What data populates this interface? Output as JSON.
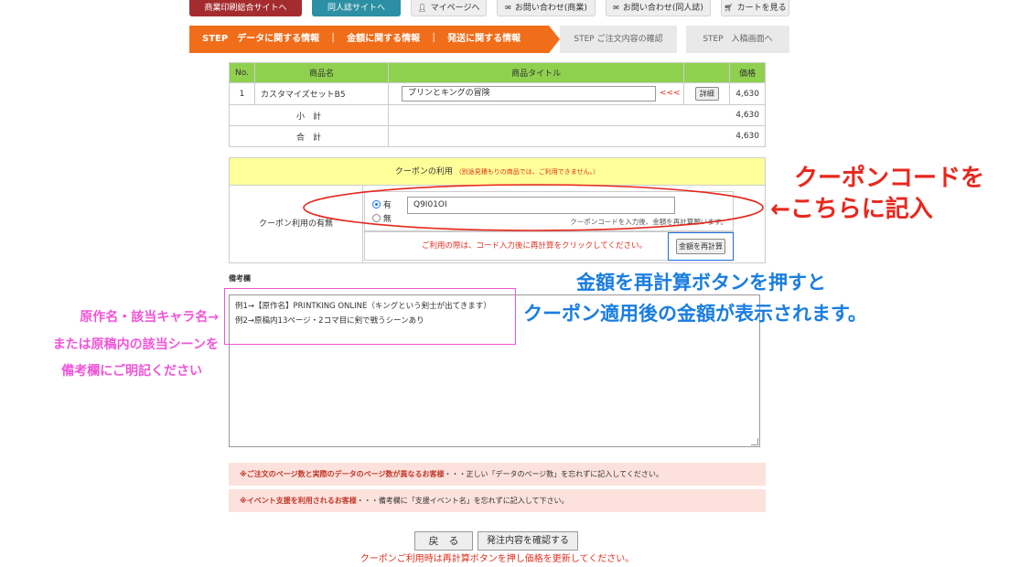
{
  "topnav": {
    "commercial_label": "商業印刷総合サイトへ",
    "doujin_label": "同人誌サイトへ",
    "mypage_label": "マイページへ",
    "contact_commercial_label": "お問い合わせ(商業)",
    "contact_doujin_label": "お問い合わせ(同人誌)",
    "cart_label": "カートを見る"
  },
  "steps": {
    "active_label": "STEP　データに関する情報　｜　金額に関する情報　｜　発送に関する情報",
    "step2_label": "STEP ご注文内容の確認",
    "step3_label": "STEP　入稿画面へ"
  },
  "items_table": {
    "headers": [
      "No.",
      "商品名",
      "商品タイトル",
      "価格"
    ],
    "rows": [
      {
        "no": "1",
        "name": "カスタマイズセットB5",
        "title": "プリンとキングの冒険",
        "arrow": "<<<",
        "detail_label": "詳細",
        "price": "4,630"
      }
    ],
    "subtotal_label": "小　計",
    "subtotal": "4,630",
    "total_label": "合　計",
    "total": "4,630"
  },
  "coupon": {
    "title": "クーポンの利用",
    "title_note": "（別途見積もりの商品では、ご利用できません。）",
    "row_label": "クーポン利用の有無",
    "yes_label": "有",
    "no_label": "無",
    "code_value": "Q9I01OI",
    "help_text": "クーポンコードを入力後、金額を再計算願います。",
    "recalc_hint": "ご利用の際は、コード入力後に再計算をクリックしてください。",
    "recalc_button": "金額を再計算",
    "selected": "yes"
  },
  "remarks": {
    "label": "備考欄",
    "line1": "例1→【原作名】PRINTKING ONLINE（キングという剣士が出てきます）",
    "line2": "例2→原稿内13ページ・2コマ目に剣で戦うシーンあり"
  },
  "notices": {
    "n1_bold": "※ご注文のページ数と実際のデータのページ数が異なるお客様",
    "n1_rest": "・・・正しい「データのページ数」を忘れずに記入してください。",
    "n2_bold": "※イベント支援を利用されるお客様",
    "n2_rest": "・・・備考欄に「支援イベント名」を忘れずに記入して下さい。"
  },
  "footer": {
    "back_label": "戻　る",
    "confirm_label": "発注内容を確認する",
    "message": "クーポンご利用時は再計算ボタンを押し価格を更新してください。"
  },
  "annotations": {
    "coupon_line1": "クーポンコードを",
    "coupon_line2": "←こちらに記入",
    "recalc_line1": "金額を再計算ボタンを押すと",
    "recalc_line2": "クーポン適用後の金額が表示されます。",
    "remarks_line1": "原作名・該当キャラ名→",
    "remarks_line2": "または原稿内の該当シーンを",
    "remarks_line3": "備考欄にご明記ください"
  },
  "colors": {
    "step_active": "#f06d1a",
    "table_header": "#8fd14f",
    "coupon_header": "#ffff99",
    "annotation_red": "#e8271c",
    "annotation_blue": "#1a7de0",
    "annotation_pink": "#f055d8"
  },
  "icons": {
    "mypage": "person-icon",
    "contact": "mail-icon",
    "cart": "cart-icon"
  }
}
